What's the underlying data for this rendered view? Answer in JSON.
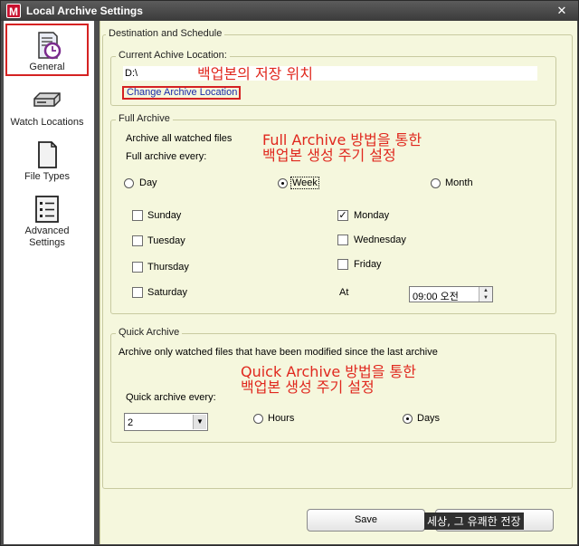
{
  "window": {
    "title": "Local Archive Settings",
    "app_icon_letter": "M",
    "close_glyph": "✕"
  },
  "sidebar": {
    "items": [
      {
        "label": "General",
        "selected": true
      },
      {
        "label": "Watch Locations"
      },
      {
        "label": "File Types"
      },
      {
        "label": "Advanced\nSettings"
      }
    ]
  },
  "destination": {
    "group_title": "Destination and Schedule",
    "current_location_label": "Current Achive Location:",
    "path_value": "D:\\",
    "change_link": "Change Archive Location",
    "annotation": "백업본의 저장 위치"
  },
  "full_archive": {
    "group_title": "Full Archive",
    "description": "Archive all watched files",
    "every_label": "Full archive every:",
    "annotation_line1": "Full Archive 방법을 통한",
    "annotation_line2": "백업본 생성 주기 설정",
    "radios": [
      {
        "label": "Day",
        "checked": false
      },
      {
        "label": "Week",
        "checked": true
      },
      {
        "label": "Month",
        "checked": false
      }
    ],
    "days": [
      {
        "label": "Sunday",
        "checked": false
      },
      {
        "label": "Monday",
        "checked": true
      },
      {
        "label": "Tuesday",
        "checked": false
      },
      {
        "label": "Wednesday",
        "checked": false
      },
      {
        "label": "Thursday",
        "checked": false
      },
      {
        "label": "Friday",
        "checked": false
      },
      {
        "label": "Saturday",
        "checked": false
      }
    ],
    "at_label": "At",
    "time_value": "09:00 오전"
  },
  "quick_archive": {
    "group_title": "Quick Archive",
    "description": "Archive only watched files that have been modified since the last archive",
    "annotation_line1": "Quick Archive 방법을 통한",
    "annotation_line2": "백업본 생성 주기 설정",
    "every_label": "Quick archive every:",
    "interval_value": "2",
    "radios": [
      {
        "label": "Hours",
        "checked": false
      },
      {
        "label": "Days",
        "checked": true
      }
    ]
  },
  "buttons": {
    "save": "Save"
  },
  "watermark": "세상, 그 유쾌한 전장"
}
